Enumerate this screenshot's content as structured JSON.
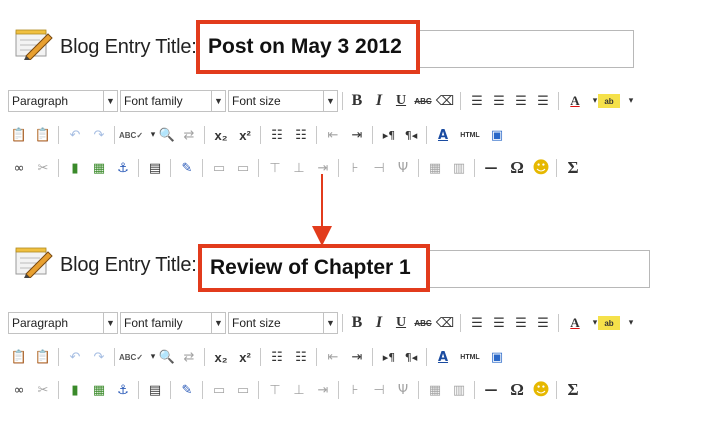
{
  "panels": [
    {
      "title_label": "Blog Entry Title:",
      "title_value": "Post on May 3 2012",
      "toolbar": {
        "format_select": "Paragraph",
        "font_family_select": "Font family",
        "font_size_select": "Font size"
      }
    },
    {
      "title_label": "Blog Entry Title:",
      "title_value": "Review of Chapter 1",
      "toolbar": {
        "format_select": "Paragraph",
        "font_family_select": "Font family",
        "font_size_select": "Font size"
      }
    }
  ],
  "toolbar_labels": {
    "bold": "B",
    "italic": "I",
    "underline": "U",
    "strike": "ABC",
    "subscript": "x₂",
    "superscript": "x²",
    "html": "HTML",
    "omega": "Ω",
    "sigma": "Σ",
    "hr": "—"
  },
  "colors": {
    "highlight_border": "#e23b1c",
    "arrow": "#e23b1c"
  }
}
